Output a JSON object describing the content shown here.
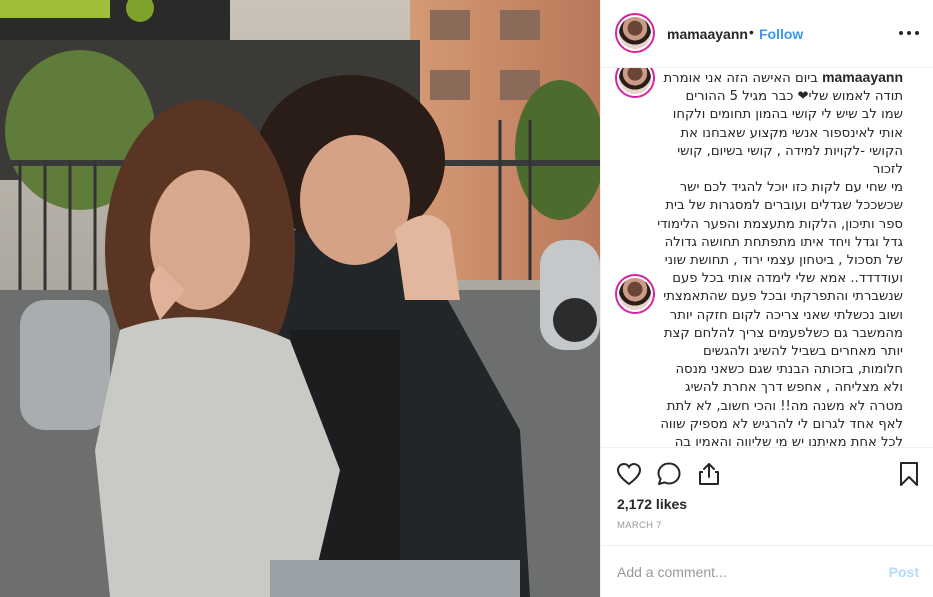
{
  "post": {
    "username": "mamaayann",
    "separator": "•",
    "follow_label": "Follow",
    "more_icon": "more-options-icon"
  },
  "caption": {
    "username": "mamaayann",
    "lines": [
      "ביום האישה הזה אני אומרת",
      "תודה לאמוש שלי❤ כבר מגיל 5 ההורים",
      "שמו לב שיש לי קושי בהמון תחומים ולקחו",
      "אותי לאינספור אנשי מקצוע שאבחנו את",
      "הקושי -לקויות למידה , קושי בשיום, קושי",
      "לזכור",
      "מי שחי עם לקות כזו יוכל להגיד לכם ישר",
      "שכשככל שגדלים ועוברים למסגרות של בית",
      "ספר ותיכון, הלקות מתעצמת והפער הלימודי",
      "גדל וגדל ויחד איתו מתפתחת תחושה גדולה",
      "של תסכול , ביטחון עצמי ירוד , תחושת שוני",
      "ועודדדד.. אמא שלי לימדה אותי בכל פעם",
      "שנשברתי והתפרקתי ובכל פעם שהתאמצתי",
      "ושוב נכשלתי שאני צריכה לקום חזקה יותר",
      "מהמשבר גם כשלפעמים צריך להלחם קצת",
      "יותר מאחרים בשביל להשיג ולהגשים",
      "חלומות, בזכותה הבנתי שגם כשאני מנסה",
      "ולא מצליחה , אחפש דרך אחרת להשיג",
      "מטרה לא משנה מה!! והכי חשוב, לא לתת",
      "לאף אחד לגרום לי להרגיש לא מספיק שווה",
      "לכל אחת מאיתנו יש מי שליווה והאמין בה"
    ]
  },
  "actions": {
    "like_icon": "heart-icon",
    "comment_icon": "comment-icon",
    "share_icon": "share-icon",
    "save_icon": "bookmark-icon"
  },
  "likes": "2,172 likes",
  "date": "MARCH 7",
  "comment": {
    "placeholder": "Add a comment...",
    "post_label": "Post"
  },
  "colors": {
    "follow": "#3897f0",
    "post_disabled": "#b3dbff",
    "meta_gray": "#999999",
    "avatar_ring": "#d6249f"
  }
}
